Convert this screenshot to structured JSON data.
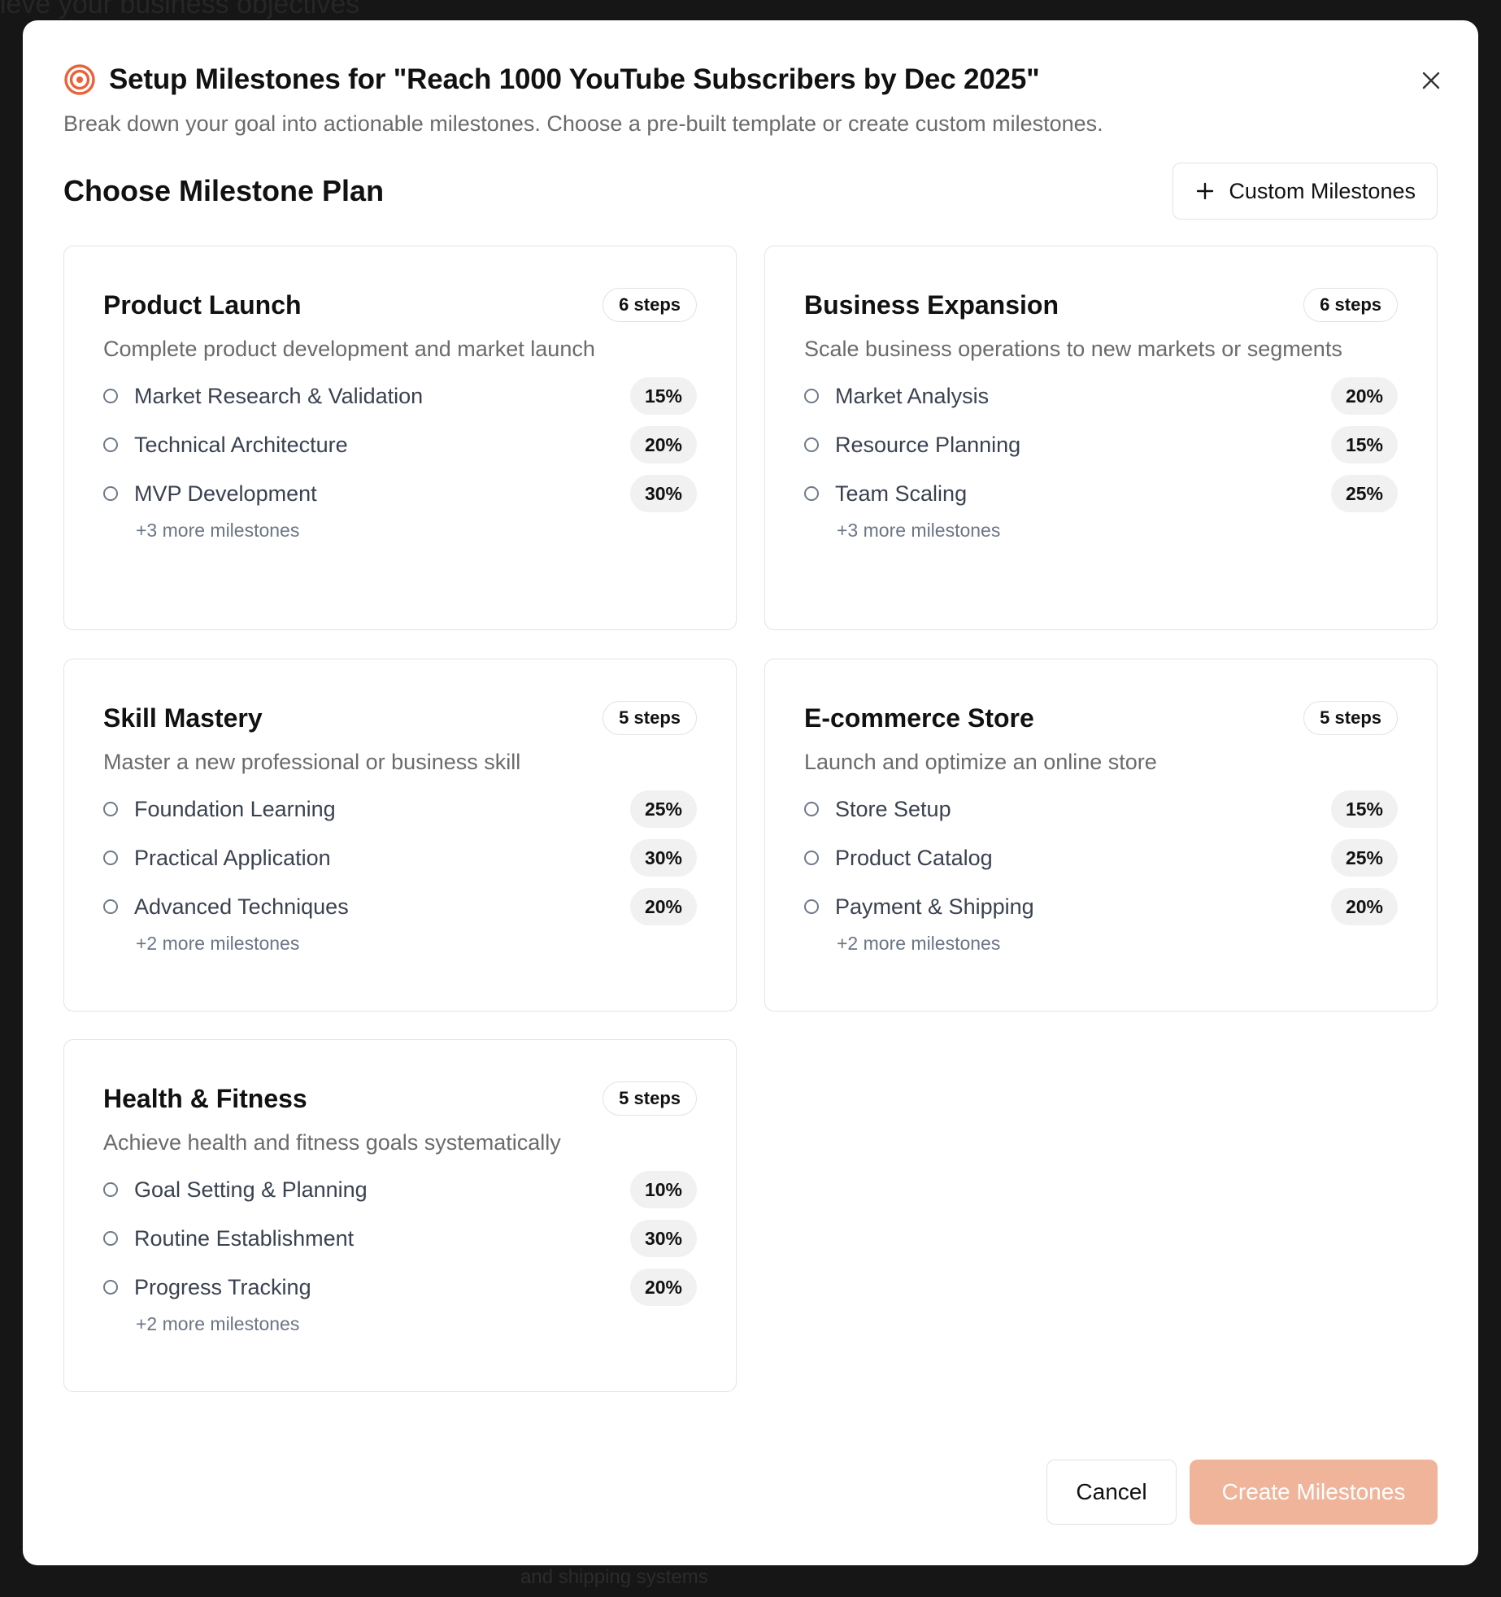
{
  "background": {
    "top_text": "ieve your business objectives",
    "bottom_text": "and shipping systems"
  },
  "dialog": {
    "title": "Setup Milestones for \"Reach 1000 YouTube Subscribers by Dec 2025\"",
    "subtitle": "Break down your goal into actionable milestones. Choose a pre-built template or create custom milestones.",
    "title_icon": "target-icon",
    "close_icon": "close-icon",
    "accent_color": "#e8623a"
  },
  "section": {
    "title": "Choose Milestone Plan",
    "custom_button": "Custom Milestones",
    "custom_icon": "plus-icon"
  },
  "templates": [
    {
      "title": "Product Launch",
      "steps": "6 steps",
      "description": "Complete product development and market launch",
      "milestones": [
        {
          "label": "Market Research & Validation",
          "pct": "15%"
        },
        {
          "label": "Technical Architecture",
          "pct": "20%"
        },
        {
          "label": "MVP Development",
          "pct": "30%"
        }
      ],
      "more": "+3 more milestones"
    },
    {
      "title": "Business Expansion",
      "steps": "6 steps",
      "description": "Scale business operations to new markets or segments",
      "milestones": [
        {
          "label": "Market Analysis",
          "pct": "20%"
        },
        {
          "label": "Resource Planning",
          "pct": "15%"
        },
        {
          "label": "Team Scaling",
          "pct": "25%"
        }
      ],
      "more": "+3 more milestones"
    },
    {
      "title": "Skill Mastery",
      "steps": "5 steps",
      "description": "Master a new professional or business skill",
      "milestones": [
        {
          "label": "Foundation Learning",
          "pct": "25%"
        },
        {
          "label": "Practical Application",
          "pct": "30%"
        },
        {
          "label": "Advanced Techniques",
          "pct": "20%"
        }
      ],
      "more": "+2 more milestones"
    },
    {
      "title": "E-commerce Store",
      "steps": "5 steps",
      "description": "Launch and optimize an online store",
      "milestones": [
        {
          "label": "Store Setup",
          "pct": "15%"
        },
        {
          "label": "Product Catalog",
          "pct": "25%"
        },
        {
          "label": "Payment & Shipping",
          "pct": "20%"
        }
      ],
      "more": "+2 more milestones"
    },
    {
      "title": "Health & Fitness",
      "steps": "5 steps",
      "description": "Achieve health and fitness goals systematically",
      "milestones": [
        {
          "label": "Goal Setting & Planning",
          "pct": "10%"
        },
        {
          "label": "Routine Establishment",
          "pct": "30%"
        },
        {
          "label": "Progress Tracking",
          "pct": "20%"
        }
      ],
      "more": "+2 more milestones"
    }
  ],
  "footer": {
    "cancel": "Cancel",
    "create": "Create Milestones",
    "create_color": "#f0b49b"
  }
}
